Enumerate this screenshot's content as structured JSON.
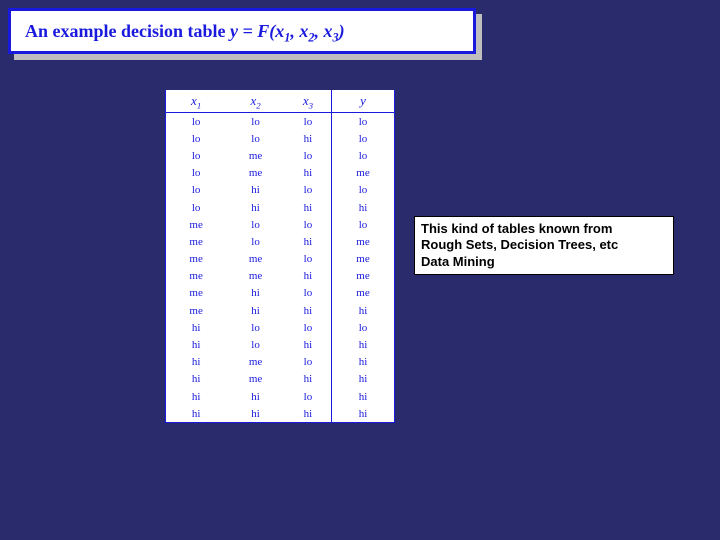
{
  "title": {
    "prefix": "An example decision table ",
    "y": "y",
    "eq": " = ",
    "F": "F",
    "lp": "(",
    "x1": "x",
    "s1": "1",
    "c1": ", ",
    "x2": "x",
    "s2": "2",
    "c2": ", ",
    "x3": "x",
    "s3": "3",
    "rp": ")"
  },
  "headers": {
    "h1": "x",
    "h1s": "1",
    "h2": "x",
    "h2s": "2",
    "h3": "x",
    "h3s": "3",
    "hy": "y"
  },
  "chart_data": {
    "type": "table",
    "title": "An example decision table y = F(x1, x2, x3)",
    "columns": [
      "x1",
      "x2",
      "x3",
      "y"
    ],
    "rows": [
      [
        "lo",
        "lo",
        "lo",
        "lo"
      ],
      [
        "lo",
        "lo",
        "hi",
        "lo"
      ],
      [
        "lo",
        "me",
        "lo",
        "lo"
      ],
      [
        "lo",
        "me",
        "hi",
        "me"
      ],
      [
        "lo",
        "hi",
        "lo",
        "lo"
      ],
      [
        "lo",
        "hi",
        "hi",
        "hi"
      ],
      [
        "me",
        "lo",
        "lo",
        "lo"
      ],
      [
        "me",
        "lo",
        "hi",
        "me"
      ],
      [
        "me",
        "me",
        "lo",
        "me"
      ],
      [
        "me",
        "me",
        "hi",
        "me"
      ],
      [
        "me",
        "hi",
        "lo",
        "me"
      ],
      [
        "me",
        "hi",
        "hi",
        "hi"
      ],
      [
        "hi",
        "lo",
        "lo",
        "lo"
      ],
      [
        "hi",
        "lo",
        "hi",
        "hi"
      ],
      [
        "hi",
        "me",
        "lo",
        "hi"
      ],
      [
        "hi",
        "me",
        "hi",
        "hi"
      ],
      [
        "hi",
        "hi",
        "lo",
        "hi"
      ],
      [
        "hi",
        "hi",
        "hi",
        "hi"
      ]
    ]
  },
  "annotation": {
    "line1": "This kind of tables known from",
    "line2": "Rough Sets, Decision Trees, etc",
    "line3": "Data Mining"
  }
}
